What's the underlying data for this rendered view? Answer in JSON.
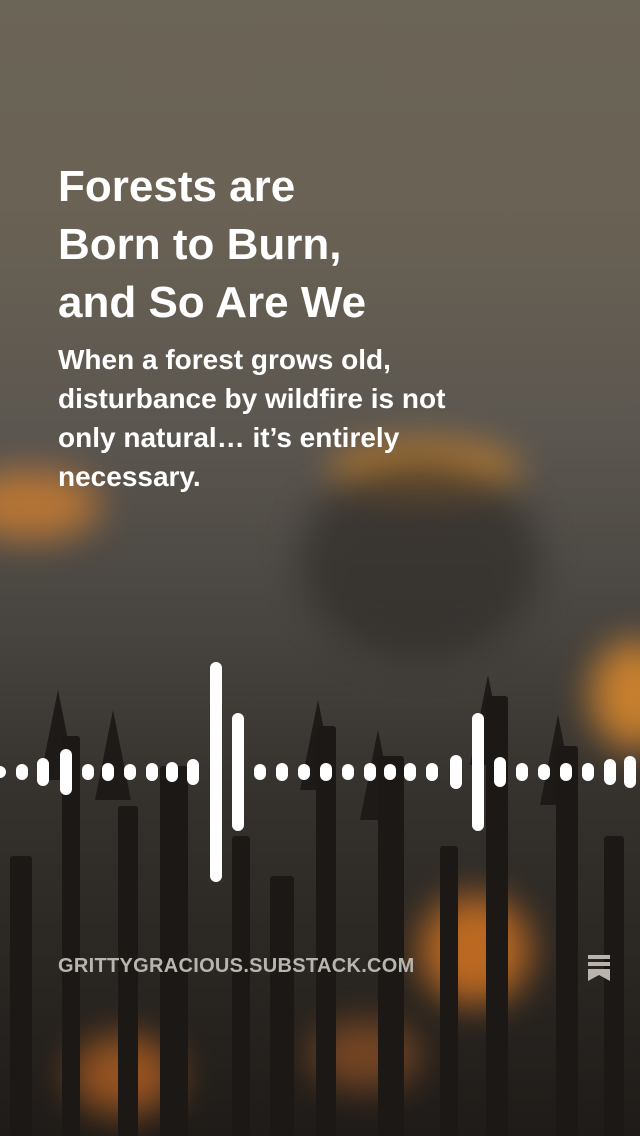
{
  "headline": {
    "lines": [
      "Forests are",
      "Born to Burn,",
      "and So Are We"
    ]
  },
  "subtext": {
    "lines": [
      "When a forest grows old,",
      "disturbance by wildfire is not",
      "only natural… it’s entirely",
      "necessary."
    ]
  },
  "footer": {
    "url": "GRITTYGRACIOUS.SUBSTACK.COM",
    "bookmark_icon": "bookmark-icon"
  },
  "colors": {
    "text_primary": "#ffffff",
    "text_muted": "#b9b4ad",
    "flame": "#e0802a"
  }
}
